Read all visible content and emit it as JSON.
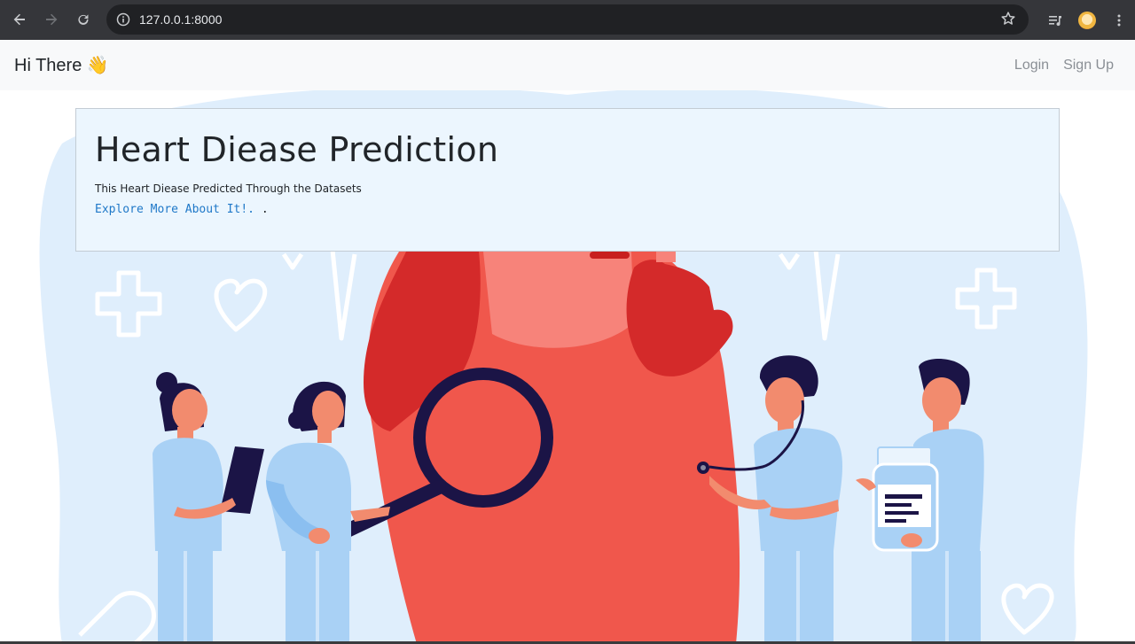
{
  "browser": {
    "url": "127.0.0.1:8000",
    "icons": [
      "back-icon",
      "forward-icon",
      "reload-icon",
      "site-info-icon",
      "bookmark-star-icon",
      "media-queue-icon",
      "profile-avatar",
      "kebab-menu-icon"
    ]
  },
  "navbar": {
    "brand": "Hi There 👋",
    "links": [
      "Login",
      "Sign Up"
    ]
  },
  "jumbotron": {
    "title": "Heart Diease Prediction",
    "subtitle": "This Heart Diease Predicted Through the Datasets",
    "link_text": "Explore More About It!.",
    "link_suffix": " ."
  },
  "colors": {
    "navbar_bg": "#f8f9fa",
    "card_bg": "#ecf6fe",
    "link": "#1f78c8",
    "heart": "#f0574c",
    "heart_dark": "#d42a2a",
    "blob": "#dfeefc",
    "scrub": "#a9d1f5",
    "navy": "#1b1446"
  }
}
